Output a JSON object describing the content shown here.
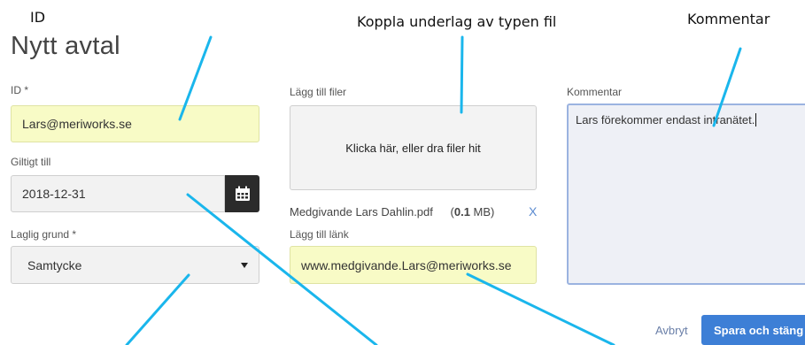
{
  "callouts": {
    "id": "ID",
    "koppla": "Koppla underlag av typen fil",
    "kommentar": "Kommentar"
  },
  "page_title": "Nytt avtal",
  "form": {
    "id_label": "ID *",
    "id_value": "Lars@meriworks.se",
    "giltigt_label": "Giltigt till",
    "giltigt_value": "2018-12-31",
    "grund_label": "Laglig grund *",
    "grund_value": "Samtycke",
    "files_label": "Lägg till filer",
    "dropzone_text": "Klicka här, eller dra filer hit",
    "file_name": "Medgivande Lars Dahlin.pdf",
    "file_size_prefix": "(",
    "file_size_value": "0.1",
    "file_size_suffix": " MB)",
    "remove_symbol": "X",
    "link_label": "Lägg till länk",
    "link_value": "www.medgivande.Lars@meriworks.se",
    "comment_label": "Kommentar",
    "comment_value": "Lars förekommer endast intranätet."
  },
  "actions": {
    "cancel_label": "Avbryt",
    "save_label": "Spara och stäng"
  },
  "colors": {
    "annotation_line": "#1ab6ec",
    "highlight_field": "#f8fbc6",
    "primary_button": "#3d7fd6"
  },
  "icons": {
    "calendar": "calendar-icon",
    "dropdown": "caret-down-icon"
  }
}
